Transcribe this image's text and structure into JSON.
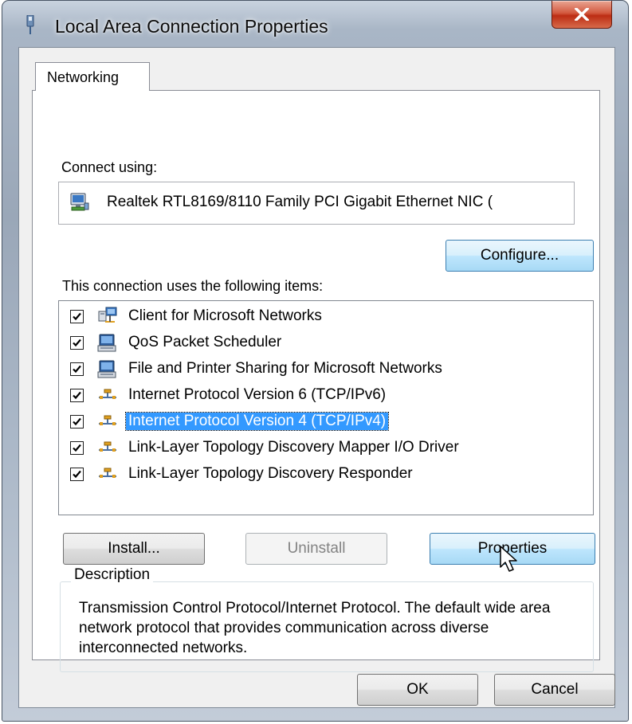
{
  "window": {
    "title": "Local Area Connection Properties"
  },
  "tabs": [
    {
      "label": "Networking",
      "selected": true
    }
  ],
  "connect_using": {
    "label": "Connect using:",
    "adapter_name": "Realtek RTL8169/8110 Family PCI Gigabit Ethernet NIC (",
    "adapter_icon": "network-adapter-icon"
  },
  "buttons": {
    "configure": "Configure...",
    "install": "Install...",
    "uninstall": "Uninstall",
    "properties": "Properties",
    "ok": "OK",
    "cancel": "Cancel"
  },
  "items_header": "This connection uses the following items:",
  "items": [
    {
      "label": "Client for Microsoft Networks",
      "checked": true,
      "icon": "network-client-icon",
      "selected": false
    },
    {
      "label": "QoS Packet Scheduler",
      "checked": true,
      "icon": "service-icon",
      "selected": false
    },
    {
      "label": "File and Printer Sharing for Microsoft Networks",
      "checked": true,
      "icon": "service-icon",
      "selected": false
    },
    {
      "label": "Internet Protocol Version 6 (TCP/IPv6)",
      "checked": true,
      "icon": "protocol-icon",
      "selected": false
    },
    {
      "label": "Internet Protocol Version 4 (TCP/IPv4)",
      "checked": true,
      "icon": "protocol-icon",
      "selected": true
    },
    {
      "label": "Link-Layer Topology Discovery Mapper I/O Driver",
      "checked": true,
      "icon": "protocol-icon",
      "selected": false
    },
    {
      "label": "Link-Layer Topology Discovery Responder",
      "checked": true,
      "icon": "protocol-icon",
      "selected": false
    }
  ],
  "description": {
    "title": "Description",
    "text": "Transmission Control Protocol/Internet Protocol. The default wide area network protocol that provides communication across diverse interconnected networks."
  },
  "colors": {
    "selection": "#3399ff",
    "hot_button": "#bee6fd",
    "close_button": "#c8381c"
  }
}
